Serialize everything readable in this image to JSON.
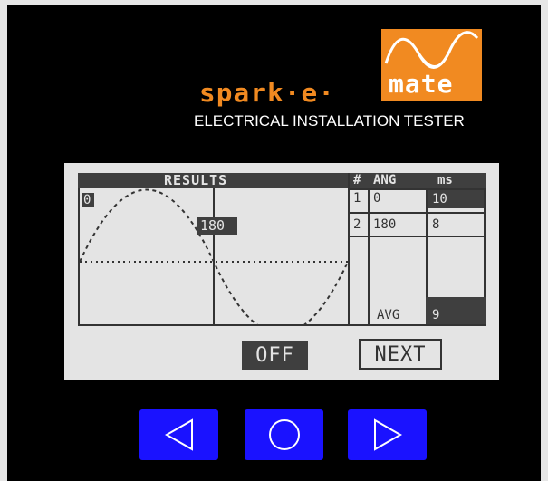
{
  "brand": {
    "name_left": "spark·e·",
    "name_right": "mate",
    "subtitle": "ELECTRICAL INSTALLATION TESTER",
    "accent_color": "#f18a21"
  },
  "screen": {
    "title": "RESULTS",
    "wave_start_label": "0",
    "wave_peak_label": "180",
    "table": {
      "headers": [
        "#",
        "ANG",
        "ms"
      ],
      "rows": [
        {
          "num": "1",
          "ang": "0",
          "ms": "10"
        },
        {
          "num": "2",
          "ang": "180",
          "ms": "8"
        }
      ],
      "avg_label": "AVG",
      "avg_value": "9"
    },
    "buttons": {
      "off_label": "OFF",
      "next_label": "NEXT"
    }
  },
  "nav": {
    "left_icon": "triangle-left-icon",
    "center_icon": "circle-icon",
    "right_icon": "triangle-right-icon",
    "button_color": "#1a12ff"
  }
}
